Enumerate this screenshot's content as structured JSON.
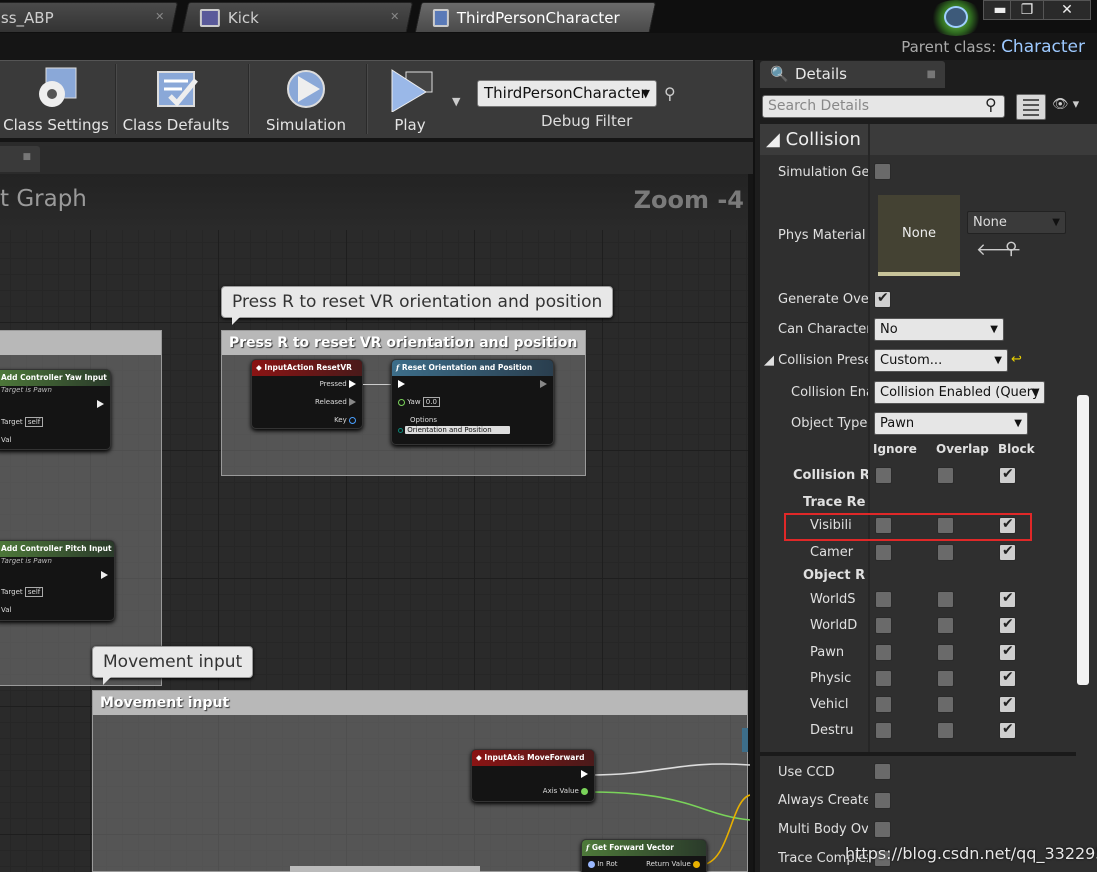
{
  "tabs": [
    {
      "label": "ss_ABP"
    },
    {
      "label": "Kick"
    },
    {
      "label": "ThirdPersonCharacter"
    }
  ],
  "window_buttons": {
    "minimize": "▬",
    "restore": "❐",
    "close": "✕"
  },
  "parent_class": {
    "label": "Parent class:",
    "value": "Character"
  },
  "toolbar": {
    "class_settings": "Class Settings",
    "class_defaults": "Class Defaults",
    "simulation": "Simulation",
    "play": "Play",
    "debug_filter_value": "ThirdPersonCharacter",
    "debug_filter_label": "Debug Filter"
  },
  "graph": {
    "title": "t Graph",
    "zoom": "Zoom -4",
    "comments": [
      {
        "bubble": "Press R to reset VR orientation and position",
        "header": "Press R to reset VR orientation and position"
      },
      {
        "bubble": "Movement input",
        "header": "Movement input"
      }
    ],
    "nodes": {
      "yaw": {
        "title": "Add Controller Yaw Input",
        "sub": "Target is Pawn",
        "target": "Target",
        "self": "self",
        "val": "Val"
      },
      "pitch": {
        "title": "Add Controller Pitch Input",
        "sub": "Target is Pawn",
        "target": "Target",
        "self": "self",
        "val": "Val"
      },
      "resetvr": {
        "title": "InputAction ResetVR",
        "pressed": "Pressed",
        "released": "Released",
        "key": "Key"
      },
      "reset": {
        "title": "Reset Orientation and Position",
        "yaw": "Yaw",
        "yaw_val": "0.0",
        "options": "Options",
        "options_val": "Orientation and Position"
      },
      "moveforward": {
        "title": "InputAxis MoveForward",
        "axis": "Axis Value"
      },
      "forward": {
        "title": "Get Forward Vector",
        "inrot": "In Rot",
        "ret": "Return Value"
      }
    }
  },
  "details": {
    "tab": "Details",
    "search_placeholder": "Search Details",
    "category": "Collision",
    "props": {
      "sim_gen": "Simulation Gene",
      "phys_mat": "Phys Material O",
      "phys_mat_preview": "None",
      "phys_mat_dd": "None",
      "gen_overlap": "Generate Overla",
      "can_char": "Can Character S",
      "can_char_dd": "No",
      "preset": "Collision Preset",
      "preset_dd": "Custom...",
      "enabled": "Collision Enab",
      "enabled_dd": "Collision Enabled (Query a",
      "obj_type": "Object Type",
      "obj_type_dd": "Pawn",
      "col_ignore": "Ignore",
      "col_overlap": "Overlap",
      "col_block": "Block",
      "col_resp": "Collision Resp",
      "trace_hdr": "Trace Re",
      "object_hdr": "Object R",
      "use_ccd": "Use CCD",
      "always_create": "Always Create P",
      "multi_body": "Multi Body Over",
      "trace_complex": "Trace Complex"
    },
    "trace_rows": [
      {
        "label": "Visibili"
      },
      {
        "label": "Camer"
      }
    ],
    "object_rows": [
      {
        "label": "WorldS"
      },
      {
        "label": "WorldD"
      },
      {
        "label": "Pawn"
      },
      {
        "label": "Physic"
      },
      {
        "label": "Vehicl"
      },
      {
        "label": "Destru"
      }
    ]
  },
  "watermark": "https://blog.csdn.net/qq_33229537"
}
